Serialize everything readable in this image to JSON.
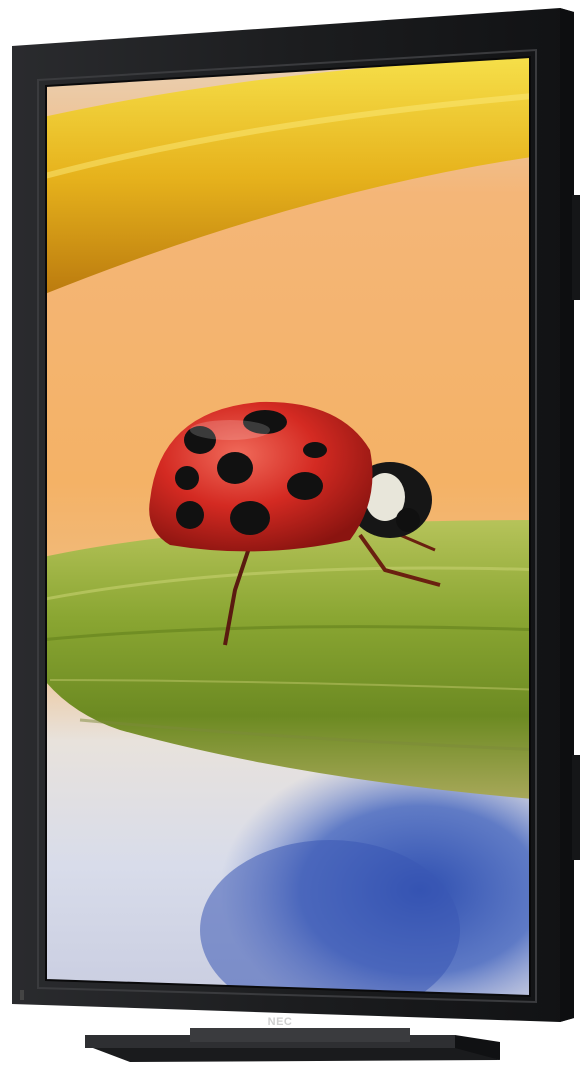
{
  "device": {
    "brand_logo": "NEC",
    "frame_color": "#1c1d1f",
    "bezel_highlight": "#3a3b3e",
    "stand_color": "#2a2b2e"
  },
  "screen_image": {
    "subject": "ladybug-photo",
    "colors": {
      "bug_shell": "#d42a22",
      "bug_spots": "#111111",
      "stem_green": "#8aa632",
      "stem_yellow": "#e4b21e",
      "background_orange": "#f2b268",
      "background_blue": "#3c5fb8"
    }
  }
}
